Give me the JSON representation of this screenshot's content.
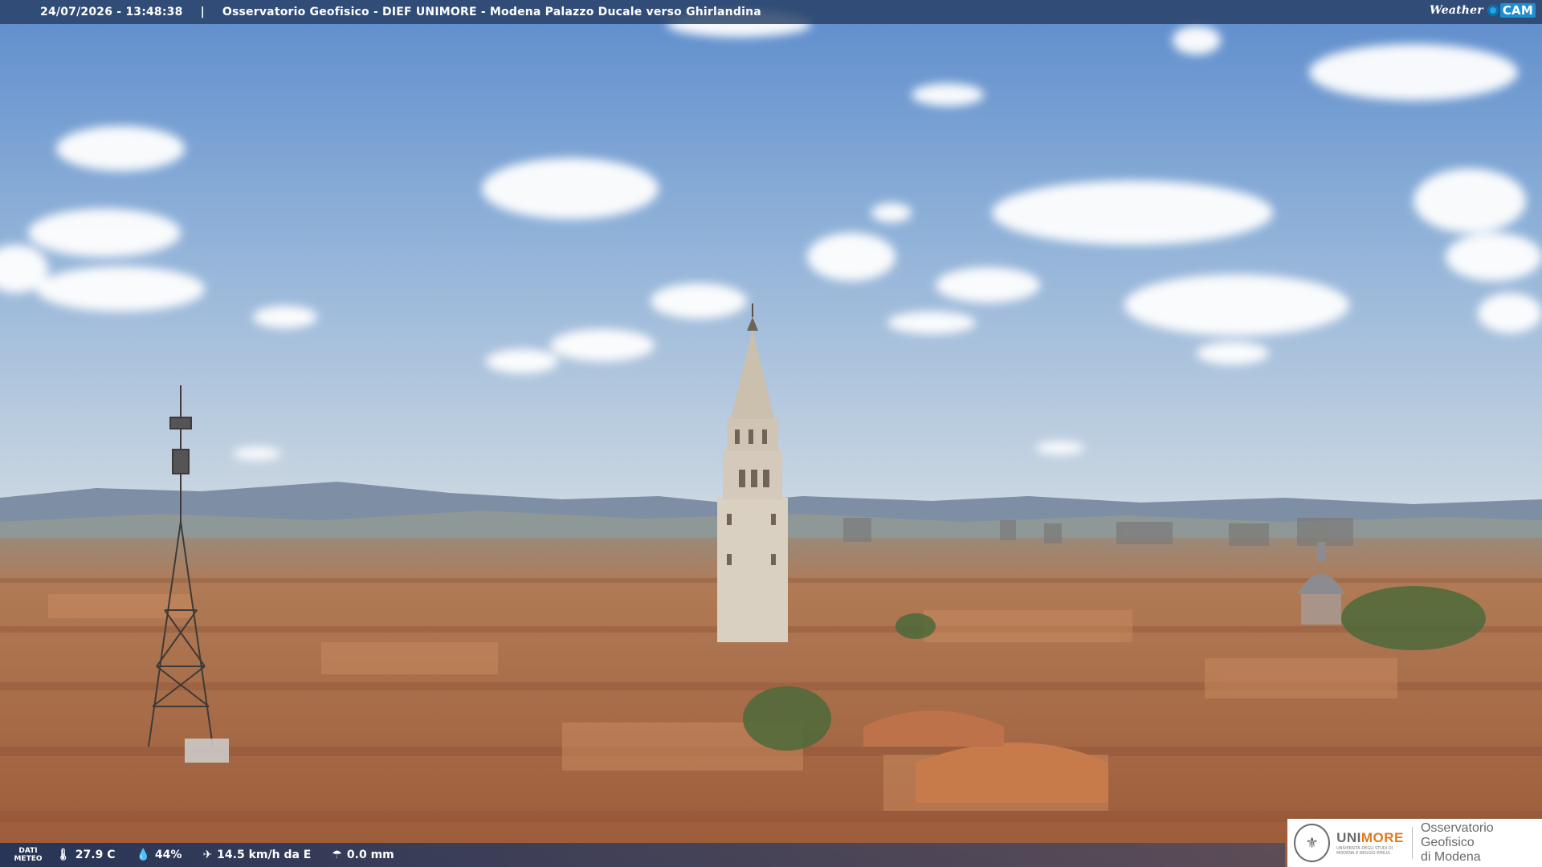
{
  "header": {
    "timestamp": "24/07/2026 - 13:48:38",
    "separator": "|",
    "title": "Osservatorio Geofisico - DIEF UNIMORE - Modena Palazzo Ducale verso Ghirlandina",
    "brand_left": "Weather",
    "brand_right": "CAM"
  },
  "weather": {
    "label_line1": "DATI",
    "label_line2": "METEO",
    "temperature": "27.9 C",
    "humidity": "44%",
    "wind": "14.5 km/h da E",
    "rain": "0.0 mm",
    "icons": {
      "temperature": "thermometer-icon",
      "humidity": "droplet-icon",
      "wind": "wind-icon",
      "rain": "rain-icon"
    }
  },
  "logo": {
    "uni_a": "UNI",
    "uni_b": "MORE",
    "uni_sub": "UNIVERSITÀ DEGLI STUDI DI MODENA E REGGIO EMILIA",
    "obs_line1": "Osservatorio Geofisico",
    "obs_line2": "di Modena"
  },
  "colors": {
    "sky_top": "#5f8fd0",
    "sky_bottom": "#c8d8e8",
    "roof": "#b8714a",
    "tower": "#d8cfc0",
    "accent": "#e07a1c"
  }
}
